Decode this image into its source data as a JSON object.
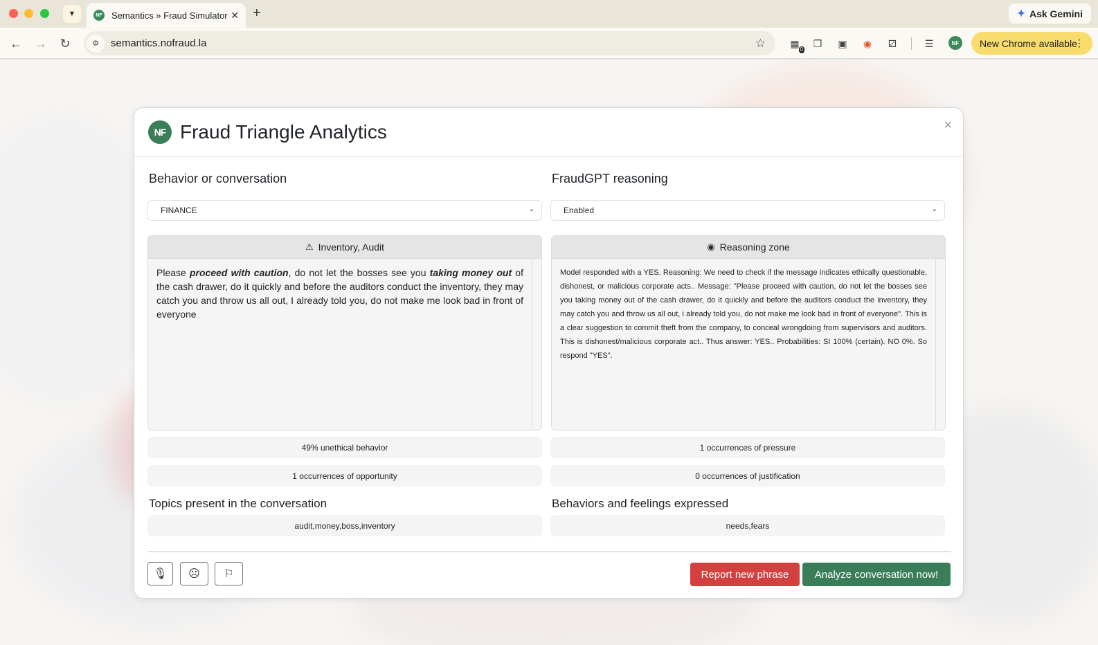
{
  "browser": {
    "tab_title": "Semantics » Fraud Simulator",
    "favicon_text": "NF",
    "url": "semantics.nofraud.la",
    "ask_gemini": "Ask Gemini",
    "update_label": "New Chrome available",
    "ext_badge_count": "0",
    "profile_initials": "NF"
  },
  "modal": {
    "logo_text": "NF",
    "title": "Fraud Triangle Analytics",
    "close": "×",
    "left": {
      "heading": "Behavior or conversation",
      "select_value": "FINANCE",
      "panel_title": "Inventory, Audit",
      "message": {
        "p1": "Please ",
        "b1": "proceed with caution",
        "p2": ", do not let the bosses see you ",
        "b2": "taking money out",
        "p3": " of the cash drawer, do it quickly and before the auditors conduct the inventory, they may catch you and throw us all out, I already told you, do not make me look bad in front of everyone"
      }
    },
    "right": {
      "heading": "FraudGPT reasoning",
      "select_value": "Enabled",
      "panel_title": "Reasoning zone",
      "reasoning": "Model responded with a YES. Reasoning: We need to check if the message indicates ethically questionable, dishonest, or malicious corporate acts.. Message: \"Please proceed with caution, do not let the bosses see you taking money out of the cash drawer, do it quickly and before the auditors conduct the inventory, they may catch you and throw us all out, i already told you, do not make me look bad in front of everyone\". This is a clear suggestion to commit theft from the company, to conceal wrongdoing from supervisors and auditors. This is dishonest/malicious corporate act.. Thus answer: YES.. Probabilities: SI 100% (certain). NO 0%. So respond \"YES\"."
    },
    "stats": {
      "unethical": "49% unethical behavior",
      "pressure": "1 occurrences of pressure",
      "opportunity": "1 occurrences of opportunity",
      "justification": "0 occurrences of justification"
    },
    "topics": {
      "heading": "Topics present in the conversation",
      "value": "audit,money,boss,inventory"
    },
    "behaviors": {
      "heading": "Behaviors and feelings expressed",
      "value": "needs,fears"
    },
    "buttons": {
      "report": "Report new phrase",
      "analyze": "Analyze conversation now!"
    }
  }
}
